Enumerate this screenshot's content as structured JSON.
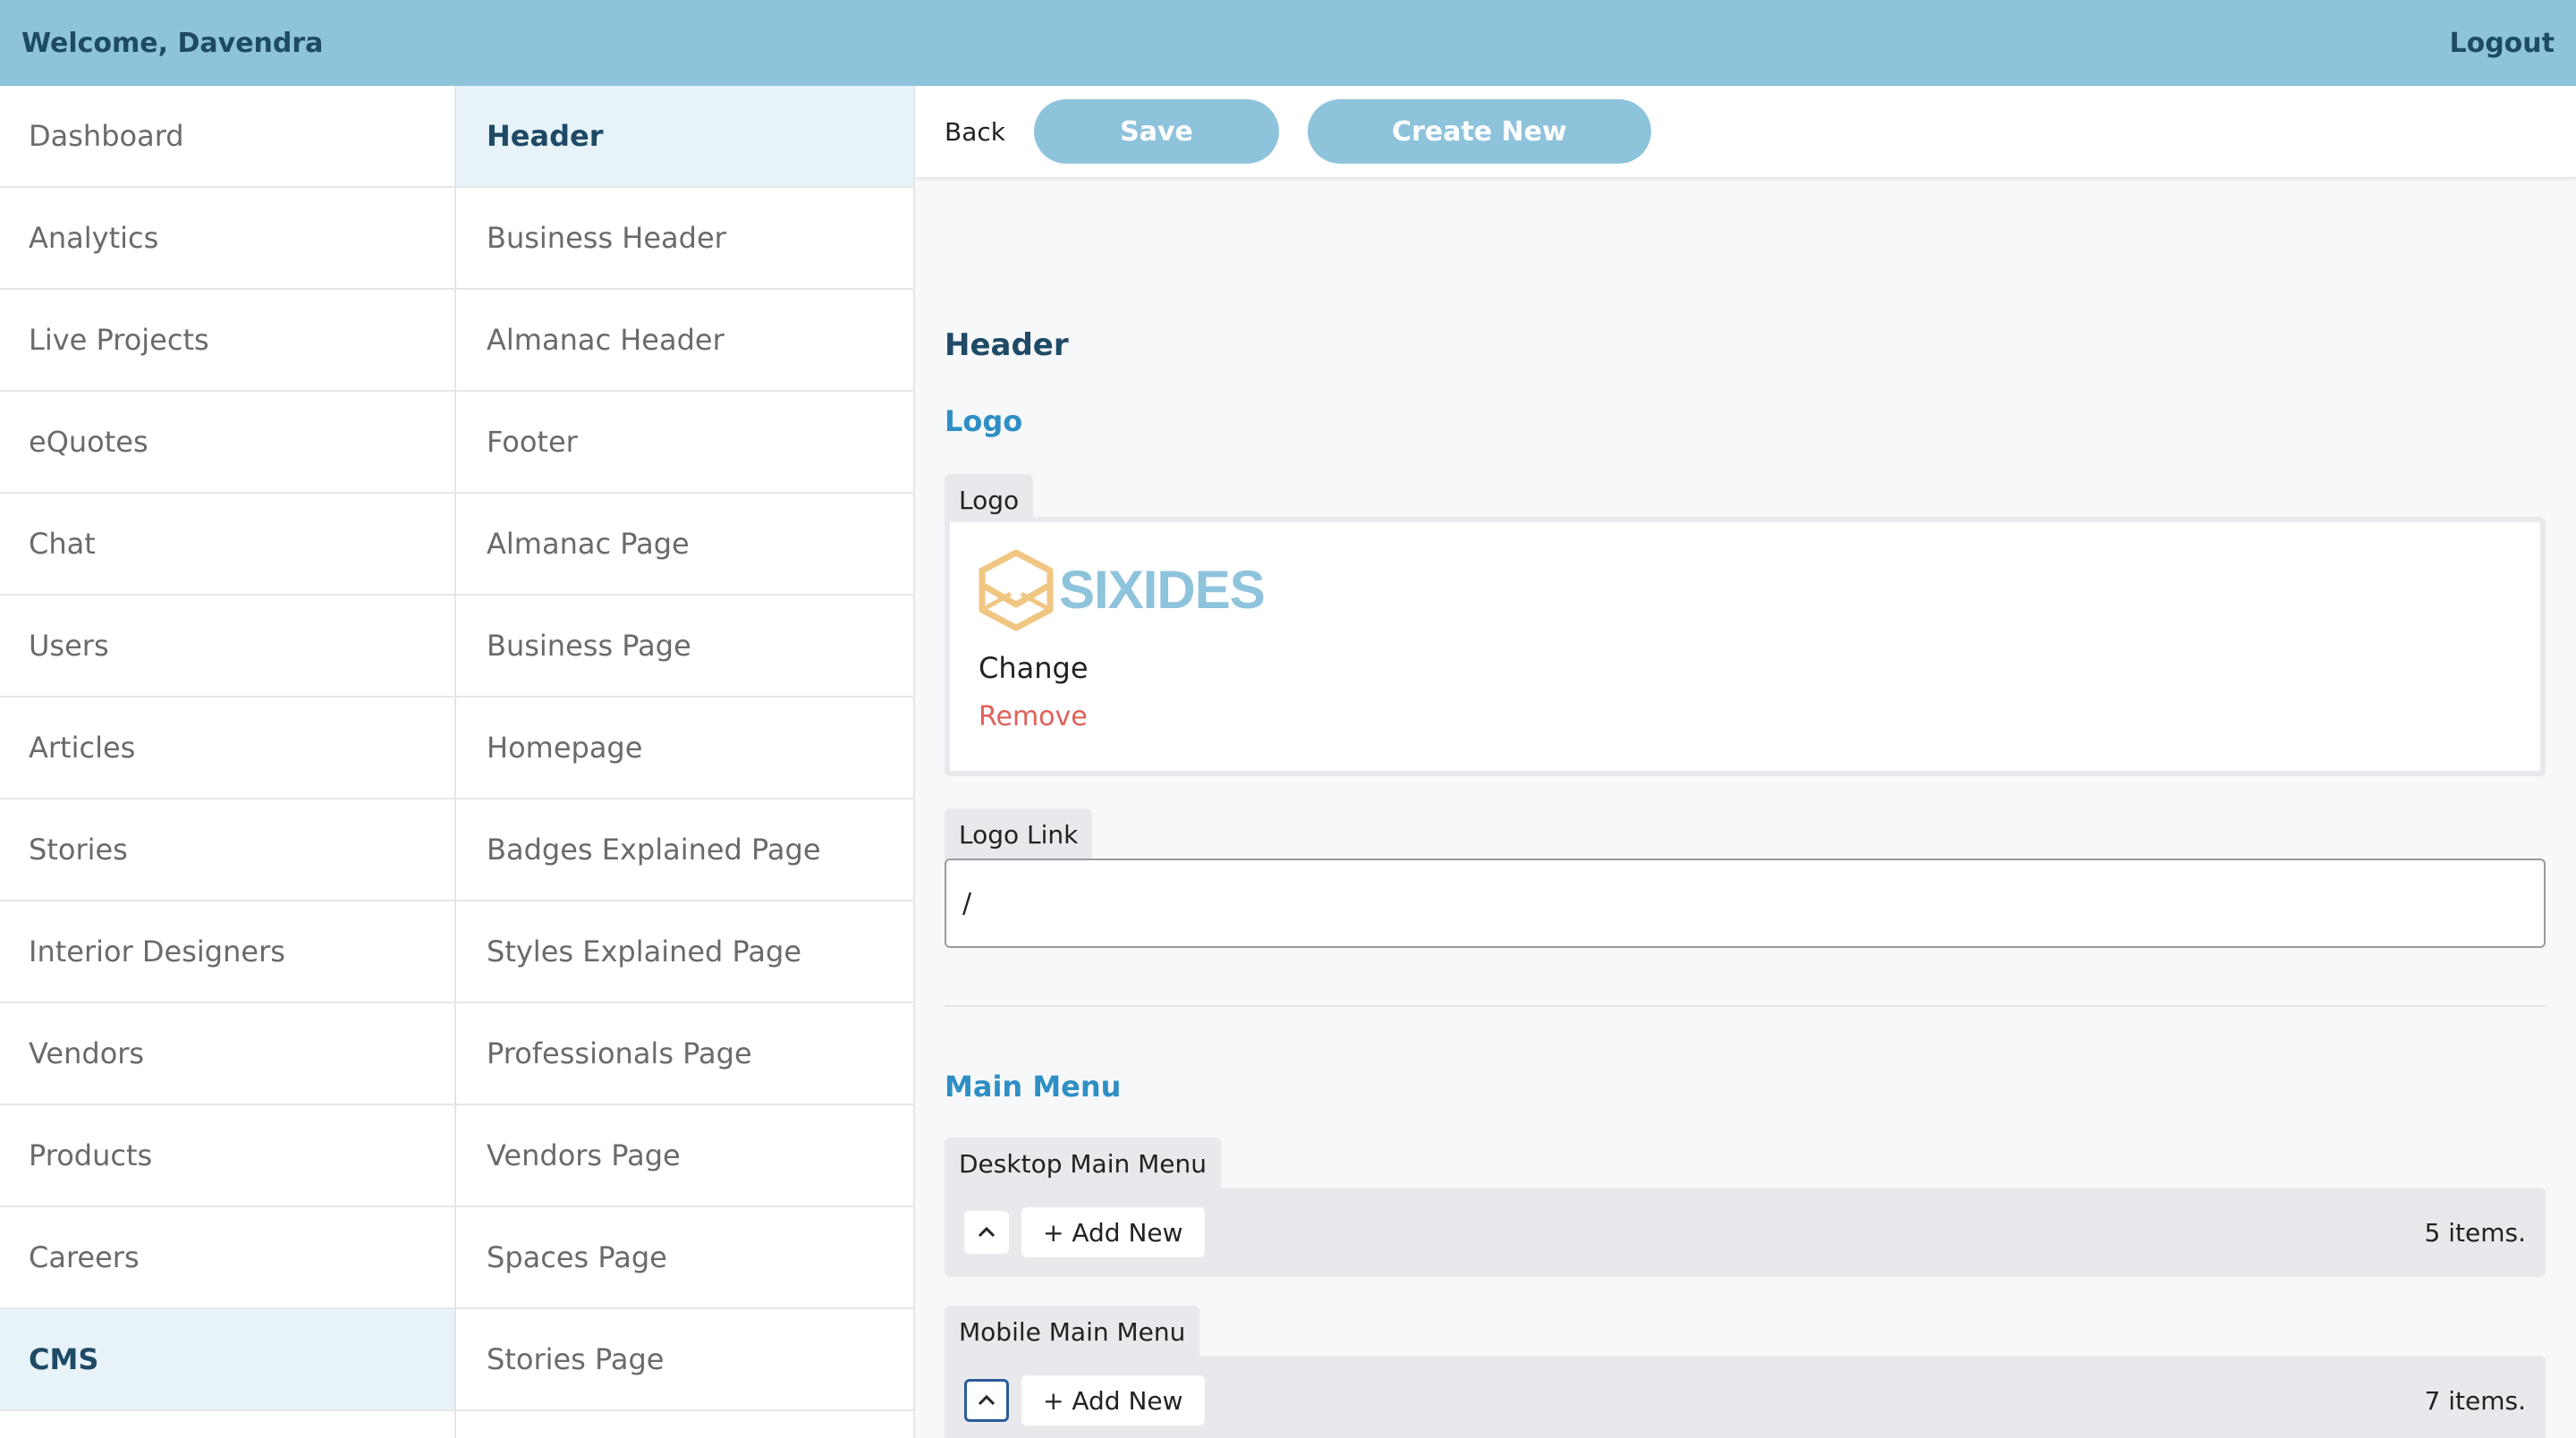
{
  "topbar": {
    "welcome": "Welcome, Davendra",
    "logout": "Logout"
  },
  "nav_primary": [
    {
      "label": "Dashboard"
    },
    {
      "label": "Analytics"
    },
    {
      "label": "Live Projects"
    },
    {
      "label": "eQuotes"
    },
    {
      "label": "Chat"
    },
    {
      "label": "Users"
    },
    {
      "label": "Articles"
    },
    {
      "label": "Stories"
    },
    {
      "label": "Interior Designers"
    },
    {
      "label": "Vendors"
    },
    {
      "label": "Products"
    },
    {
      "label": "Careers"
    },
    {
      "label": "CMS",
      "active": true
    }
  ],
  "nav_secondary": [
    {
      "label": "Header",
      "active": true
    },
    {
      "label": "Business Header"
    },
    {
      "label": "Almanac Header"
    },
    {
      "label": "Footer"
    },
    {
      "label": "Almanac Page"
    },
    {
      "label": "Business Page"
    },
    {
      "label": "Homepage"
    },
    {
      "label": "Badges Explained Page"
    },
    {
      "label": "Styles Explained Page"
    },
    {
      "label": "Professionals Page"
    },
    {
      "label": "Vendors Page"
    },
    {
      "label": "Spaces Page"
    },
    {
      "label": "Stories Page"
    }
  ],
  "toolbar": {
    "back": "Back",
    "save": "Save",
    "create_new": "Create New"
  },
  "editor": {
    "title": "Header",
    "logo_section": "Logo",
    "logo_field_label": "Logo",
    "logo_brand_text": "SIXIDES",
    "logo_change": "Change",
    "logo_remove": "Remove",
    "logo_link_label": "Logo Link",
    "logo_link_value": "/",
    "main_menu_section": "Main Menu",
    "desktop_menu_label": "Desktop Main Menu",
    "desktop_add_new": "+ Add New",
    "desktop_count": "5 items.",
    "mobile_menu_label": "Mobile Main Menu",
    "mobile_add_new": "+ Add New",
    "mobile_count": "7 items."
  },
  "colors": {
    "accent": "#8ec3dc",
    "heading": "#1e4a66",
    "link": "#2f8fc4",
    "danger": "#e0605a",
    "logo_orange": "#f0c682",
    "logo_blue": "#8ec3dc"
  },
  "icons": {
    "collapse": "chevron-up-icon",
    "logo_mark": "hexagon-envelope-icon"
  }
}
